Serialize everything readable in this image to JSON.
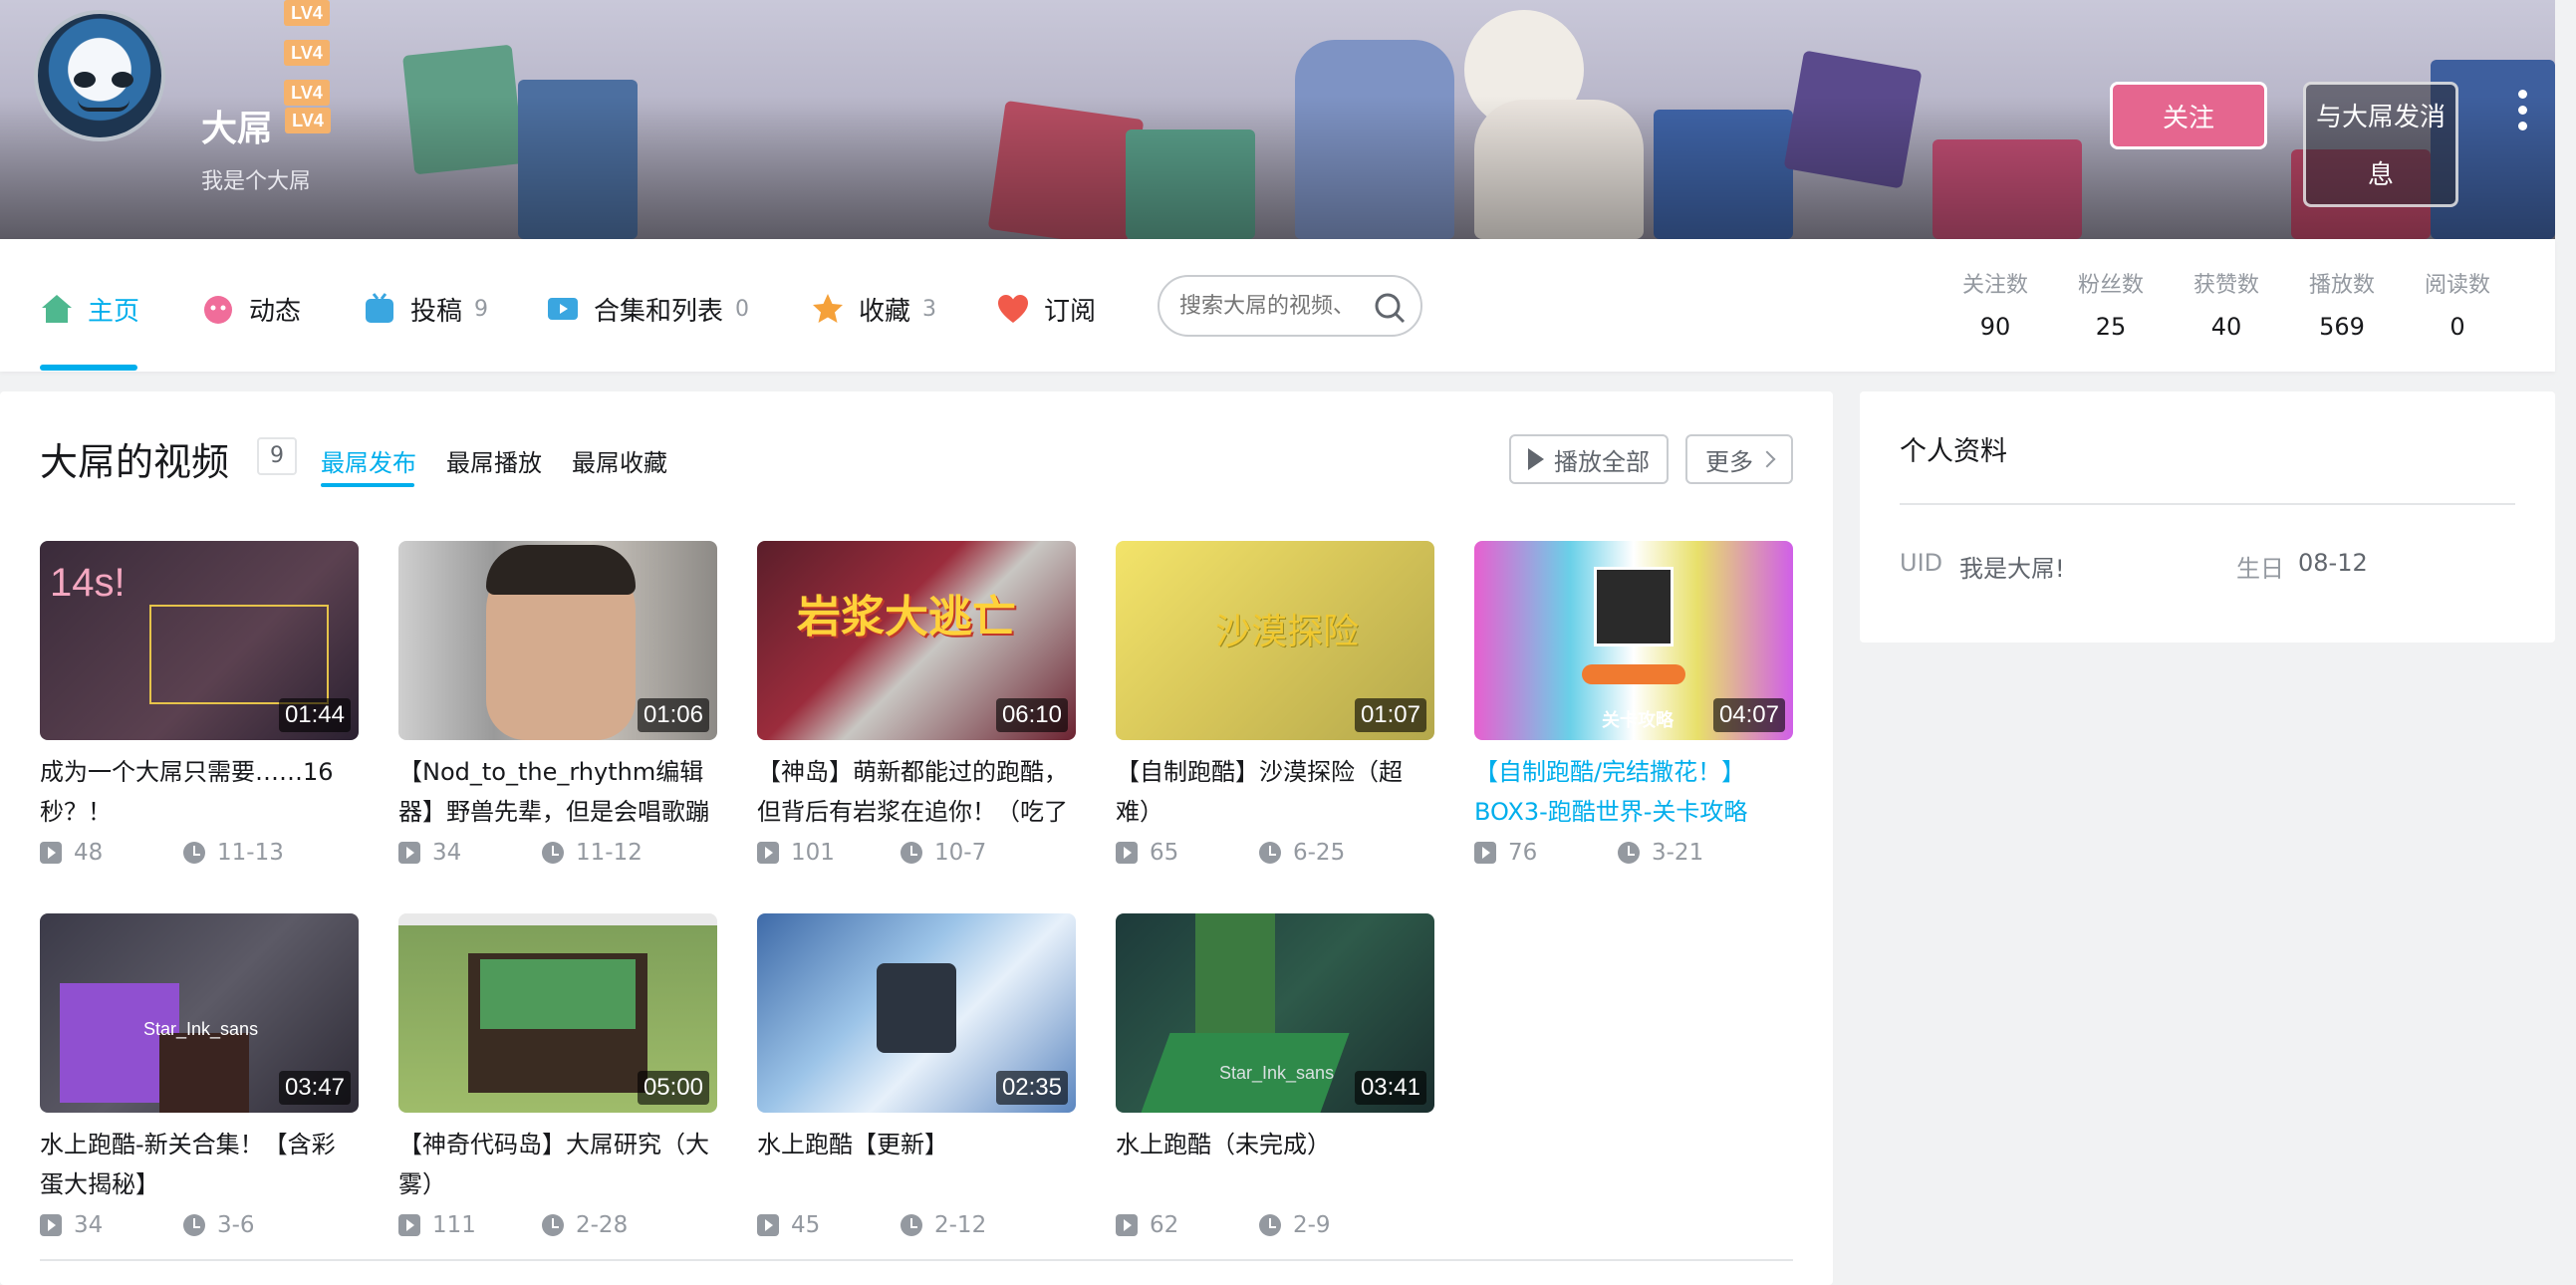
{
  "banner": {
    "username": "大屌",
    "level": "LV4",
    "level_stack": [
      "LV4",
      "LV4",
      "LV4"
    ],
    "signature": "我是个大屌",
    "follow_label": "关注",
    "message_label": "与大屌发消息"
  },
  "nav": {
    "items": [
      {
        "label": "主页",
        "count": ""
      },
      {
        "label": "动态",
        "count": ""
      },
      {
        "label": "投稿",
        "count": "9"
      },
      {
        "label": "合集和列表",
        "count": "0"
      },
      {
        "label": "收藏",
        "count": "3"
      },
      {
        "label": "订阅",
        "count": ""
      }
    ],
    "search_placeholder": "搜索大屌的视频、",
    "stats": [
      {
        "label": "关注数",
        "value": "90"
      },
      {
        "label": "粉丝数",
        "value": "25"
      },
      {
        "label": "获赞数",
        "value": "40"
      },
      {
        "label": "播放数",
        "value": "569"
      },
      {
        "label": "阅读数",
        "value": "0"
      }
    ]
  },
  "videos_section": {
    "title": "大屌的视频",
    "count": "9",
    "tabs": [
      "最屌发布",
      "最屌播放",
      "最屌收藏"
    ],
    "play_all": "播放全部",
    "more": "更多",
    "items": [
      {
        "title": "成为一个大屌只需要……16秒？！",
        "duration": "01:44",
        "plays": "48",
        "date": "11-13",
        "thumb_text": "14s!"
      },
      {
        "title": "【Nod_to_the_rhythm编辑器】野兽先辈，但是会唱歌蹦",
        "duration": "01:06",
        "plays": "34",
        "date": "11-12",
        "thumb_text": ""
      },
      {
        "title": "【神岛】萌新都能过的跑酷，但背后有岩浆在追你！（吃了",
        "duration": "06:10",
        "plays": "101",
        "date": "10-7",
        "thumb_text": "岩浆大逃亡"
      },
      {
        "title": "【自制跑酷】沙漠探险（超难）",
        "duration": "01:07",
        "plays": "65",
        "date": "6-25",
        "thumb_text": "沙漠探险"
      },
      {
        "title": "【自制跑酷/完结撒花！】BOX3-跑酷世界-关卡攻略",
        "duration": "04:07",
        "plays": "76",
        "date": "3-21",
        "thumb_text": "关卡攻略"
      },
      {
        "title": "水上跑酷-新关合集！【含彩蛋大揭秘】",
        "duration": "03:47",
        "plays": "34",
        "date": "3-6",
        "thumb_text": "Star_Ink_sans"
      },
      {
        "title": "【神奇代码岛】大屌研究（大雾）",
        "duration": "05:00",
        "plays": "111",
        "date": "2-28",
        "thumb_text": ""
      },
      {
        "title": "水上跑酷【更新】",
        "duration": "02:35",
        "plays": "45",
        "date": "2-12",
        "thumb_text": ""
      },
      {
        "title": "水上跑酷（未完成）",
        "duration": "03:41",
        "plays": "62",
        "date": "2-9",
        "thumb_text": "Star_Ink_sans"
      }
    ]
  },
  "profile": {
    "title": "个人资料",
    "uid_label": "UID",
    "uid_value": "我是大屌!",
    "birthday_label": "生日",
    "birthday_value": "08-12"
  },
  "colors": {
    "accent": "#00aeec",
    "follow": "#e5668f"
  }
}
